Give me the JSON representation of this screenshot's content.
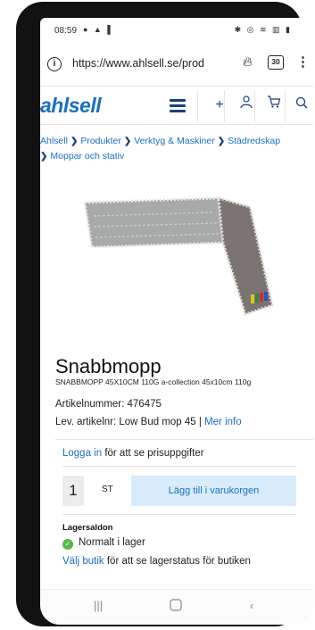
{
  "status_bar": {
    "time": "08:59",
    "left_icons": "● ▲ ▌",
    "right_icons": "✱ ◎ ≋ ▥ ▮"
  },
  "browser": {
    "url": "https://www.ahlsell.se/prod",
    "tab_count": "30",
    "menu_glyph": "⋮"
  },
  "header": {
    "logo": "ahlsell",
    "icons": [
      "menu-icon",
      "plus-icon",
      "user-icon",
      "cart-icon",
      "search-icon"
    ]
  },
  "breadcrumb": [
    "Ahlsell",
    "Produkter",
    "Verktyg & Maskiner",
    "Städredskap",
    "Moppar och stativ"
  ],
  "product": {
    "title": "Snabbmopp",
    "subtitle": "SNABBMOPP 45X10CM 110G a-collection 45x10cm 110g",
    "article_number": "Artikelnummer: 476475",
    "supplier_number": "Lev. artikelnr: Low Bud mop 45 | ",
    "more_info": "Mer info"
  },
  "pricing": {
    "login_link": "Logga in",
    "login_text": " för att se prisuppgifter"
  },
  "cart": {
    "quantity": "1",
    "unit": "ST",
    "add_button": "Lägg till i varukorgen"
  },
  "stock": {
    "label": "Lagersaldon",
    "status": "Normalt i lager",
    "store_link": "Välj butik",
    "store_text": " för att se lagerstatus för butiken"
  },
  "colors": {
    "brand_blue": "#1a6fc2",
    "nav_blue": "#1b3f78",
    "button_bg": "#d8ecfb",
    "in_stock_green": "#57b947"
  }
}
